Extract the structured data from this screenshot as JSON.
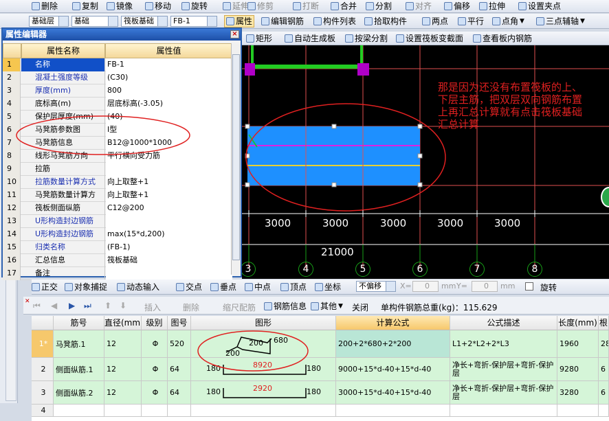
{
  "toolbar1": {
    "buttons": [
      "删除",
      "复制",
      "镜像",
      "移动",
      "旋转",
      "延伸",
      "修剪",
      "打断",
      "合并",
      "分割",
      "对齐",
      "偏移",
      "拉伸",
      "设置夹点"
    ]
  },
  "toolbar2": {
    "combo_layer": "基础层",
    "combo_type": "基础",
    "combo_subtype": "筏板基础",
    "combo_name": "FB-1",
    "property_button": "属性",
    "edit_rebar_button": "编辑钢筋",
    "component_list_button": "构件列表",
    "pick_component_button": "拾取构件",
    "two_points": "两点",
    "parallel": "平行",
    "point_angle": "点角",
    "three_point_aux": "三点辅轴"
  },
  "toolbar3": {
    "rect": "矩形",
    "auto_generate": "自动生成板",
    "split_by_beam": "按梁分割",
    "set_slope": "设置筏板变截面",
    "view_rebar": "查看板内钢筋"
  },
  "property_editor": {
    "title": "属性编辑器",
    "col_name": "属性名称",
    "col_value": "属性值",
    "rows": [
      {
        "n": "1",
        "k": "名称",
        "v": "FB-1"
      },
      {
        "n": "2",
        "k": "混凝土强度等级",
        "v": "(C30)"
      },
      {
        "n": "3",
        "k": "厚度(mm)",
        "v": "800"
      },
      {
        "n": "4",
        "k": "底标高(m)",
        "v": "层底标高(-3.05)"
      },
      {
        "n": "5",
        "k": "保护层厚度(mm)",
        "v": "(40)"
      },
      {
        "n": "6",
        "k": "马凳筋参数图",
        "v": "Ⅰ型"
      },
      {
        "n": "7",
        "k": "马凳筋信息",
        "v": "B12@1000*1000"
      },
      {
        "n": "8",
        "k": "线形马凳筋方向",
        "v": "平行横向受力筋"
      },
      {
        "n": "9",
        "k": "拉筋",
        "v": ""
      },
      {
        "n": "10",
        "k": "拉筋数量计算方式",
        "v": "向上取整+1"
      },
      {
        "n": "11",
        "k": "马凳筋数量计算方",
        "v": "向上取整+1"
      },
      {
        "n": "12",
        "k": "筏板侧面纵筋",
        "v": "C12@200"
      },
      {
        "n": "13",
        "k": "U形构造封边钢筋",
        "v": ""
      },
      {
        "n": "14",
        "k": "U形构造封边钢筋",
        "v": "max(15*d,200)"
      },
      {
        "n": "15",
        "k": "归类名称",
        "v": "(FB-1)"
      },
      {
        "n": "16",
        "k": "汇总信息",
        "v": "筏板基础"
      },
      {
        "n": "17",
        "k": "备注",
        "v": ""
      }
    ]
  },
  "canvas": {
    "annotation": "那是因为还没有布置筏板的上、下层主筋，把双层双向钢筋布置上再汇总计算就有点击筏板基础汇总计算",
    "dims": [
      "3000",
      "3000",
      "3000",
      "3000",
      "3000"
    ],
    "total": "21000",
    "axes": [
      "3",
      "4",
      "5",
      "6",
      "7",
      "8"
    ]
  },
  "statusbar": {
    "ortho": "正交",
    "snap": "对象捕捉",
    "dynamic_input": "动态输入",
    "intersection": "交点",
    "perpendicular": "垂点",
    "midpoint": "中点",
    "vertex": "顶点",
    "coordinate": "坐标",
    "offset_combo": "不偏移",
    "x_label": "X=",
    "x_value": "0",
    "y_label": "Y=",
    "y_value": "0",
    "mm1": "mm",
    "mm2": "mm",
    "rotate": "旋转"
  },
  "rebar_toolbar": {
    "insert": "插入",
    "delete": "删除",
    "scale": "缩尺配筋",
    "rebar_info": "钢筋信息",
    "other": "其他",
    "close": "关闭",
    "total_weight": "单构件钢筋总重(kg)：115.629"
  },
  "table": {
    "headers": [
      "筋号",
      "直径(mm)",
      "级别",
      "图号",
      "图形",
      "计算公式",
      "公式描述",
      "长度(mm)",
      "根"
    ],
    "rows": [
      {
        "idx": "1*",
        "name": "马凳筋.1",
        "dia": "12",
        "grade": "Φ",
        "fig": "520",
        "shape": {
          "a": "200",
          "b": "200",
          "c": "680"
        },
        "formula": "200+2*680+2*200",
        "desc": "L1+2*L2+2*L3",
        "len": "1960",
        "cnt": "28"
      },
      {
        "idx": "2",
        "name": "侧面纵筋.1",
        "dia": "12",
        "grade": "Φ",
        "fig": "64",
        "shape": {
          "l": "180",
          "m": "8920",
          "r": "180"
        },
        "formula": "9000+15*d-40+15*d-40",
        "desc": "净长+弯折-保护层+弯折-保护层",
        "len": "9280",
        "cnt": "6"
      },
      {
        "idx": "3",
        "name": "侧面纵筋.2",
        "dia": "12",
        "grade": "Φ",
        "fig": "64",
        "shape": {
          "l": "180",
          "m": "2920",
          "r": "180"
        },
        "formula": "3000+15*d-40+15*d-40",
        "desc": "净长+弯折-保护层+弯折-保护层",
        "len": "3280",
        "cnt": "6"
      },
      {
        "idx": "4",
        "name": "",
        "dia": "",
        "grade": "",
        "fig": "",
        "shape": {},
        "formula": "",
        "desc": "",
        "len": "",
        "cnt": ""
      }
    ]
  },
  "colors": {
    "canvas_bg": "#000000",
    "slab": "#1e90ff",
    "beam": "#22cc22",
    "red_mark": "#e02020"
  }
}
